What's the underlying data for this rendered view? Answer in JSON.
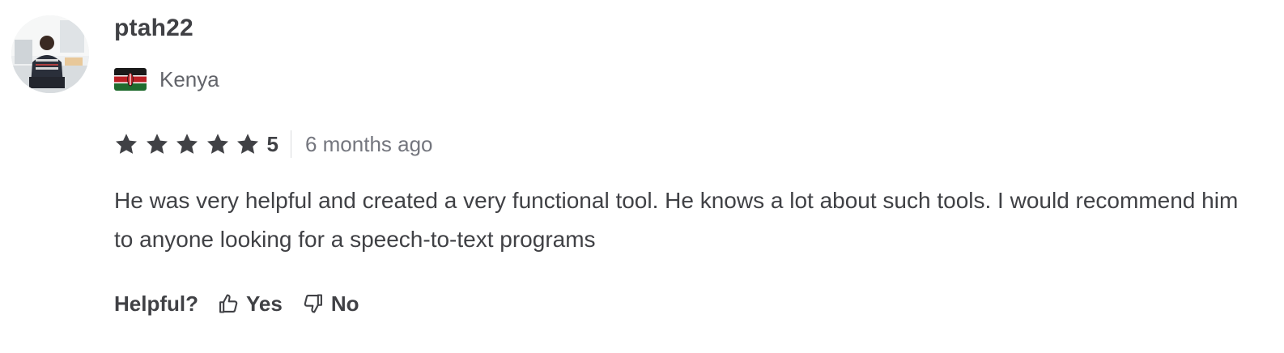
{
  "reviewer": {
    "username": "ptah22",
    "country": "Kenya",
    "flag_icon": "kenya-flag-icon",
    "avatar_icon": "user-avatar"
  },
  "rating": {
    "stars": 5,
    "value": "5",
    "time_ago": "6 months ago",
    "star_color": "#404145"
  },
  "review": {
    "text": "He was very helpful and created a very functional tool. He knows a lot about such tools. I would recommend him to anyone looking for a speech-to-text programs"
  },
  "helpful": {
    "label": "Helpful?",
    "yes_label": "Yes",
    "no_label": "No",
    "yes_icon": "thumbs-up-icon",
    "no_icon": "thumbs-down-icon"
  }
}
